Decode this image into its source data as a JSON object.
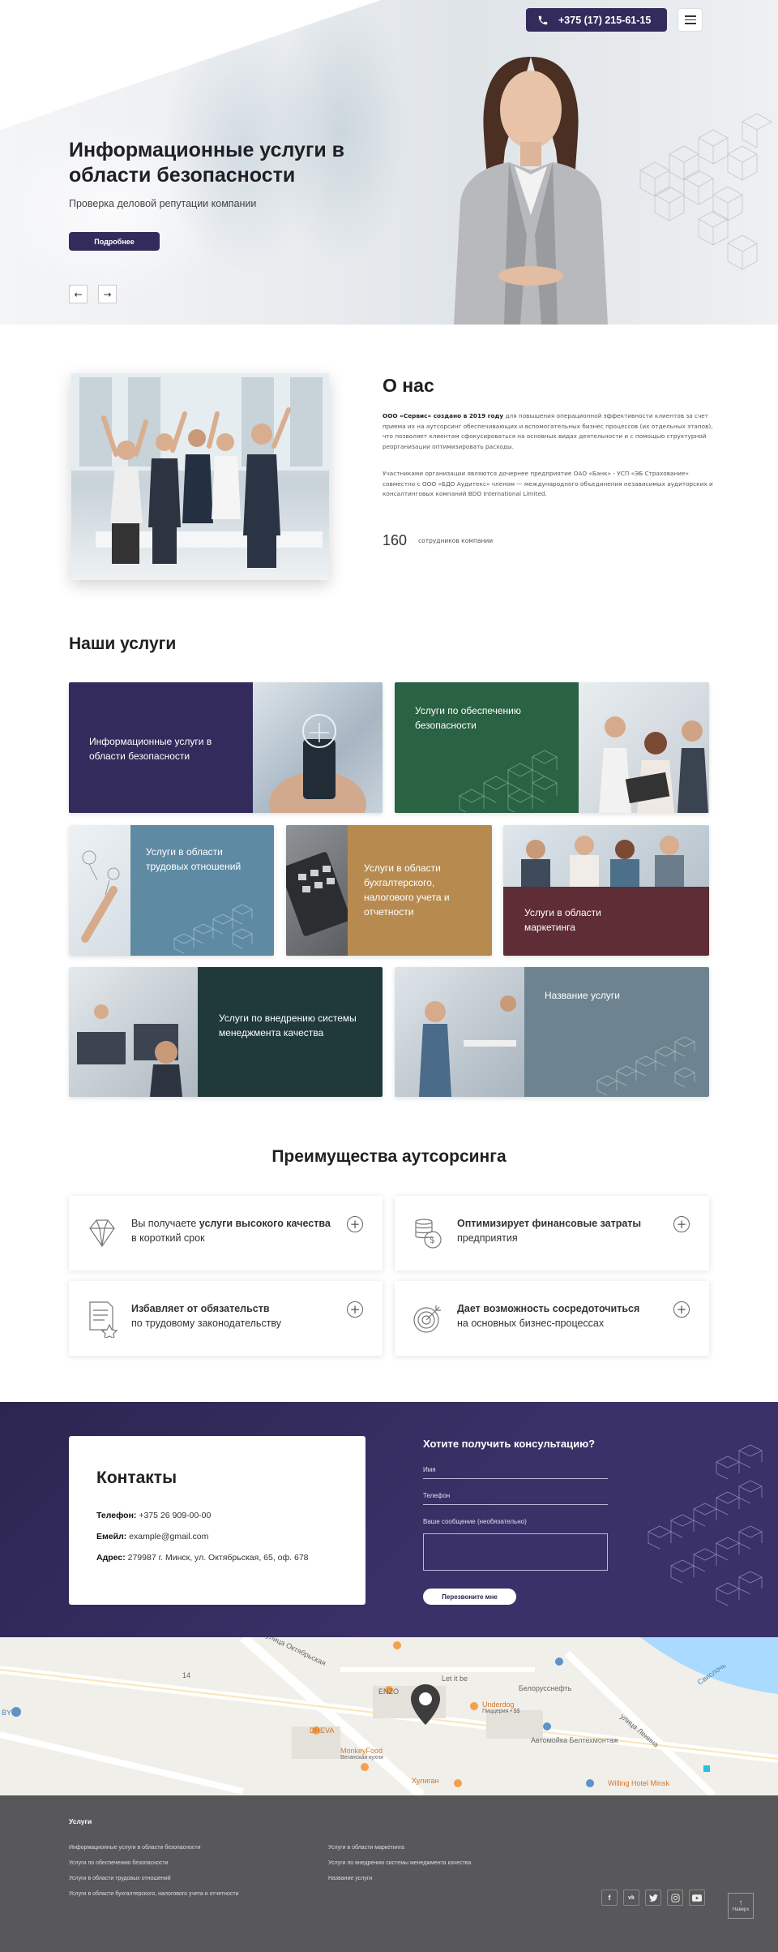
{
  "header": {
    "phone": "+375 (17) 215-61-15"
  },
  "hero": {
    "title": "Информационные услуги в области безопасности",
    "subtitle": "Проверка деловой репутации компании",
    "button": "Подробнее",
    "prev": "←",
    "next": "→"
  },
  "about": {
    "title": "О нас",
    "p1_bold": "ООО «Сервис» создано в 2019 году",
    "p1_rest": " для повышения операционной эффективности клиентов за счет приема их на аутсорсинг обеспечивающих и вспомогательных бизнес процессов (их отдельных этапов), что позволяет клиентам сфокусироваться на основных видах деятельности и с помощью структурной реорганизации оптимизировать расходы.",
    "p2": "Участниками организации являются дочернее предприятие ОАО «Банк» - УСП «ЭБ Страхование» совместно с ООО «БДО Аудитекс» членом — международного объединения независимых аудиторских и консалтинговых компаний BDO International Limited.",
    "stat_number": "160",
    "stat_label": "сотрудников компании"
  },
  "services": {
    "title": "Наши услуги",
    "cards": [
      {
        "label": "Информационные услуги в области безопасности"
      },
      {
        "label": "Услуги по обеспечению безопасности"
      },
      {
        "label": "Услуги в области трудовых отношений"
      },
      {
        "label": "Услуги в области бухгалтерского, налогового учета и отчетности"
      },
      {
        "label": "Услуги в области маркетинга"
      },
      {
        "label": "Услуги по внедрению системы менеджмента качества"
      },
      {
        "label": "Название услуги"
      }
    ]
  },
  "advantages": {
    "title": "Преимущества аутсорсинга",
    "items": [
      {
        "pre": "Вы получаете ",
        "bold": "услуги высокого качества",
        "post": " в короткий срок",
        "icon": "diamond-icon"
      },
      {
        "pre": "",
        "bold": "Оптимизирует финансовые затраты",
        "post": " предприятия",
        "icon": "coins-icon"
      },
      {
        "pre": "",
        "bold": "Избавляет от обязательств",
        "post": " по трудовому законодательству",
        "icon": "document-icon"
      },
      {
        "pre": "",
        "bold": "Дает возможность сосредоточиться",
        "post": " на основных бизнес-процессах",
        "icon": "target-icon"
      }
    ],
    "plus": "+"
  },
  "contacts": {
    "title": "Контакты",
    "phone_label": "Телефон:",
    "phone": " +375 26 909-00-00",
    "email_label": "Емейл:",
    "email": " example@gmail.com",
    "address_label": "Адрес:",
    "address": " 279987 г. Минск, ул. Октябрьская, 65, оф. 678"
  },
  "form": {
    "title": "Хотите получить консультацию?",
    "name_label": "Имя",
    "phone_label": "Телефон",
    "message_label": "Ваше сообщение (необязательно)",
    "button": "Перезвоните мне"
  },
  "map": {
    "labels": [
      "улица Октябрьская",
      "Let it be",
      "ENZO",
      "Underdog",
      "Пиццерия • $$",
      "Белорусснефть",
      "DREVA",
      "MonkeyFood",
      "Веганская кухня",
      "Автомойка Белтехмонтаж",
      "Хулиган",
      "Willing Hotel Minsk",
      "Свислочь",
      "улица Ленина",
      "14",
      "BY"
    ]
  },
  "footer": {
    "title": "Услуги",
    "col1": [
      "Информационные услуги в области безопасности",
      "Услуги по обеспечению безопасности",
      "Услуги в области трудовых отношений",
      "Услуги в области бухгалтерского, налогового учета и отчетности"
    ],
    "col2": [
      "Услуги в области маркетинга",
      "Услуги по внедрению системы менеджмента качества",
      "Название услуги"
    ],
    "social": [
      "f",
      "vk",
      "tw",
      "ig",
      "yt"
    ],
    "to_top": "Наверх"
  }
}
